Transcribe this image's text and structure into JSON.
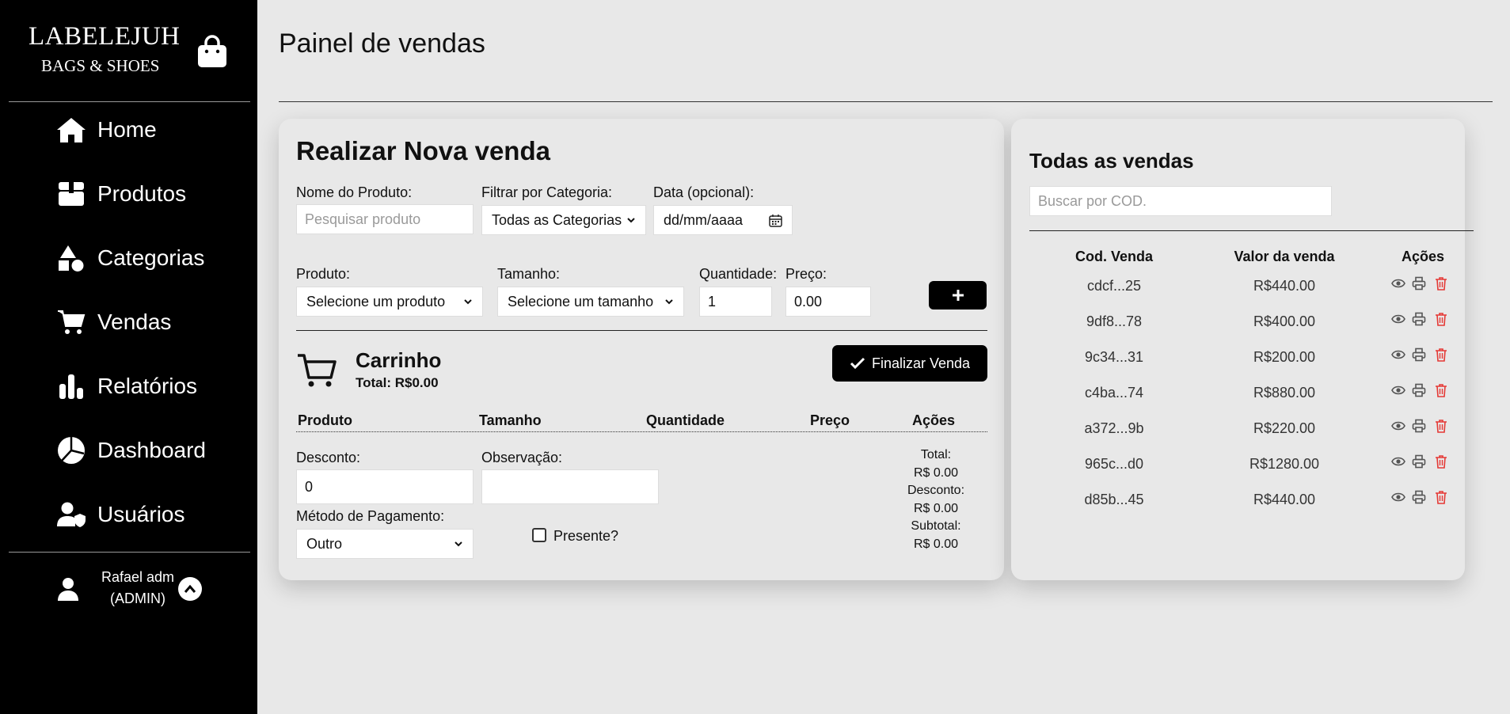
{
  "brand": {
    "name": "LABELEJUH",
    "subtitle": "BAGS & SHOES"
  },
  "nav": [
    {
      "label": "Home",
      "icon": "home-icon"
    },
    {
      "label": "Produtos",
      "icon": "box-icon"
    },
    {
      "label": "Categorias",
      "icon": "shapes-icon"
    },
    {
      "label": "Vendas",
      "icon": "cart-icon"
    },
    {
      "label": "Relatórios",
      "icon": "bar-chart-icon"
    },
    {
      "label": "Dashboard",
      "icon": "pie-chart-icon"
    },
    {
      "label": "Usuários",
      "icon": "user-shield-icon"
    }
  ],
  "user": {
    "name": "Rafael adm",
    "role": "(ADMIN)"
  },
  "page": {
    "title": "Painel de vendas"
  },
  "new_sale": {
    "title": "Realizar Nova venda",
    "product_name_label": "Nome do Produto:",
    "product_search_placeholder": "Pesquisar produto",
    "category_label": "Filtrar por Categoria:",
    "category_value": "Todas as Categorias",
    "date_label": "Data (opcional):",
    "date_value": "dd/mm/aaaa",
    "product_label": "Produto:",
    "product_value": "Selecione um produto",
    "size_label": "Tamanho:",
    "size_value": "Selecione um tamanho",
    "quantity_label": "Quantidade:",
    "quantity_value": "1",
    "price_label": "Preço:",
    "price_value": "0.00",
    "add_label": "+"
  },
  "cart": {
    "title": "Carrinho",
    "total": "Total: R$0.00",
    "finalize_label": "Finalizar Venda",
    "columns": [
      "Produto",
      "Tamanho",
      "Quantidade",
      "Preço",
      "Ações"
    ]
  },
  "checkout": {
    "discount_label": "Desconto:",
    "discount_value": "0",
    "note_label": "Observação:",
    "note_value": "",
    "payment_label": "Método de Pagamento:",
    "payment_value": "Outro",
    "gift_label": "Presente?",
    "gift_checked": false,
    "summary": {
      "total_label": "Total:",
      "total_value": "R$ 0.00",
      "discount_label": "Desconto:",
      "discount_value": "R$ 0.00",
      "subtotal_label": "Subtotal:",
      "subtotal_value": "R$ 0.00"
    }
  },
  "all_sales": {
    "title": "Todas as vendas",
    "search_placeholder": "Buscar por COD.",
    "columns": [
      "Cod. Venda",
      "Valor da venda",
      "Ações"
    ],
    "rows": [
      {
        "code": "cdcf...25",
        "value": "R$440.00"
      },
      {
        "code": "9df8...78",
        "value": "R$400.00"
      },
      {
        "code": "9c34...31",
        "value": "R$200.00"
      },
      {
        "code": "c4ba...74",
        "value": "R$880.00"
      },
      {
        "code": "a372...9b",
        "value": "R$220.00"
      },
      {
        "code": "965c...d0",
        "value": "R$1280.00"
      },
      {
        "code": "d85b...45",
        "value": "R$440.00"
      }
    ]
  },
  "colors": {
    "sidebar": "#000000",
    "background": "#e8e8e8",
    "delete": "#e53935"
  }
}
